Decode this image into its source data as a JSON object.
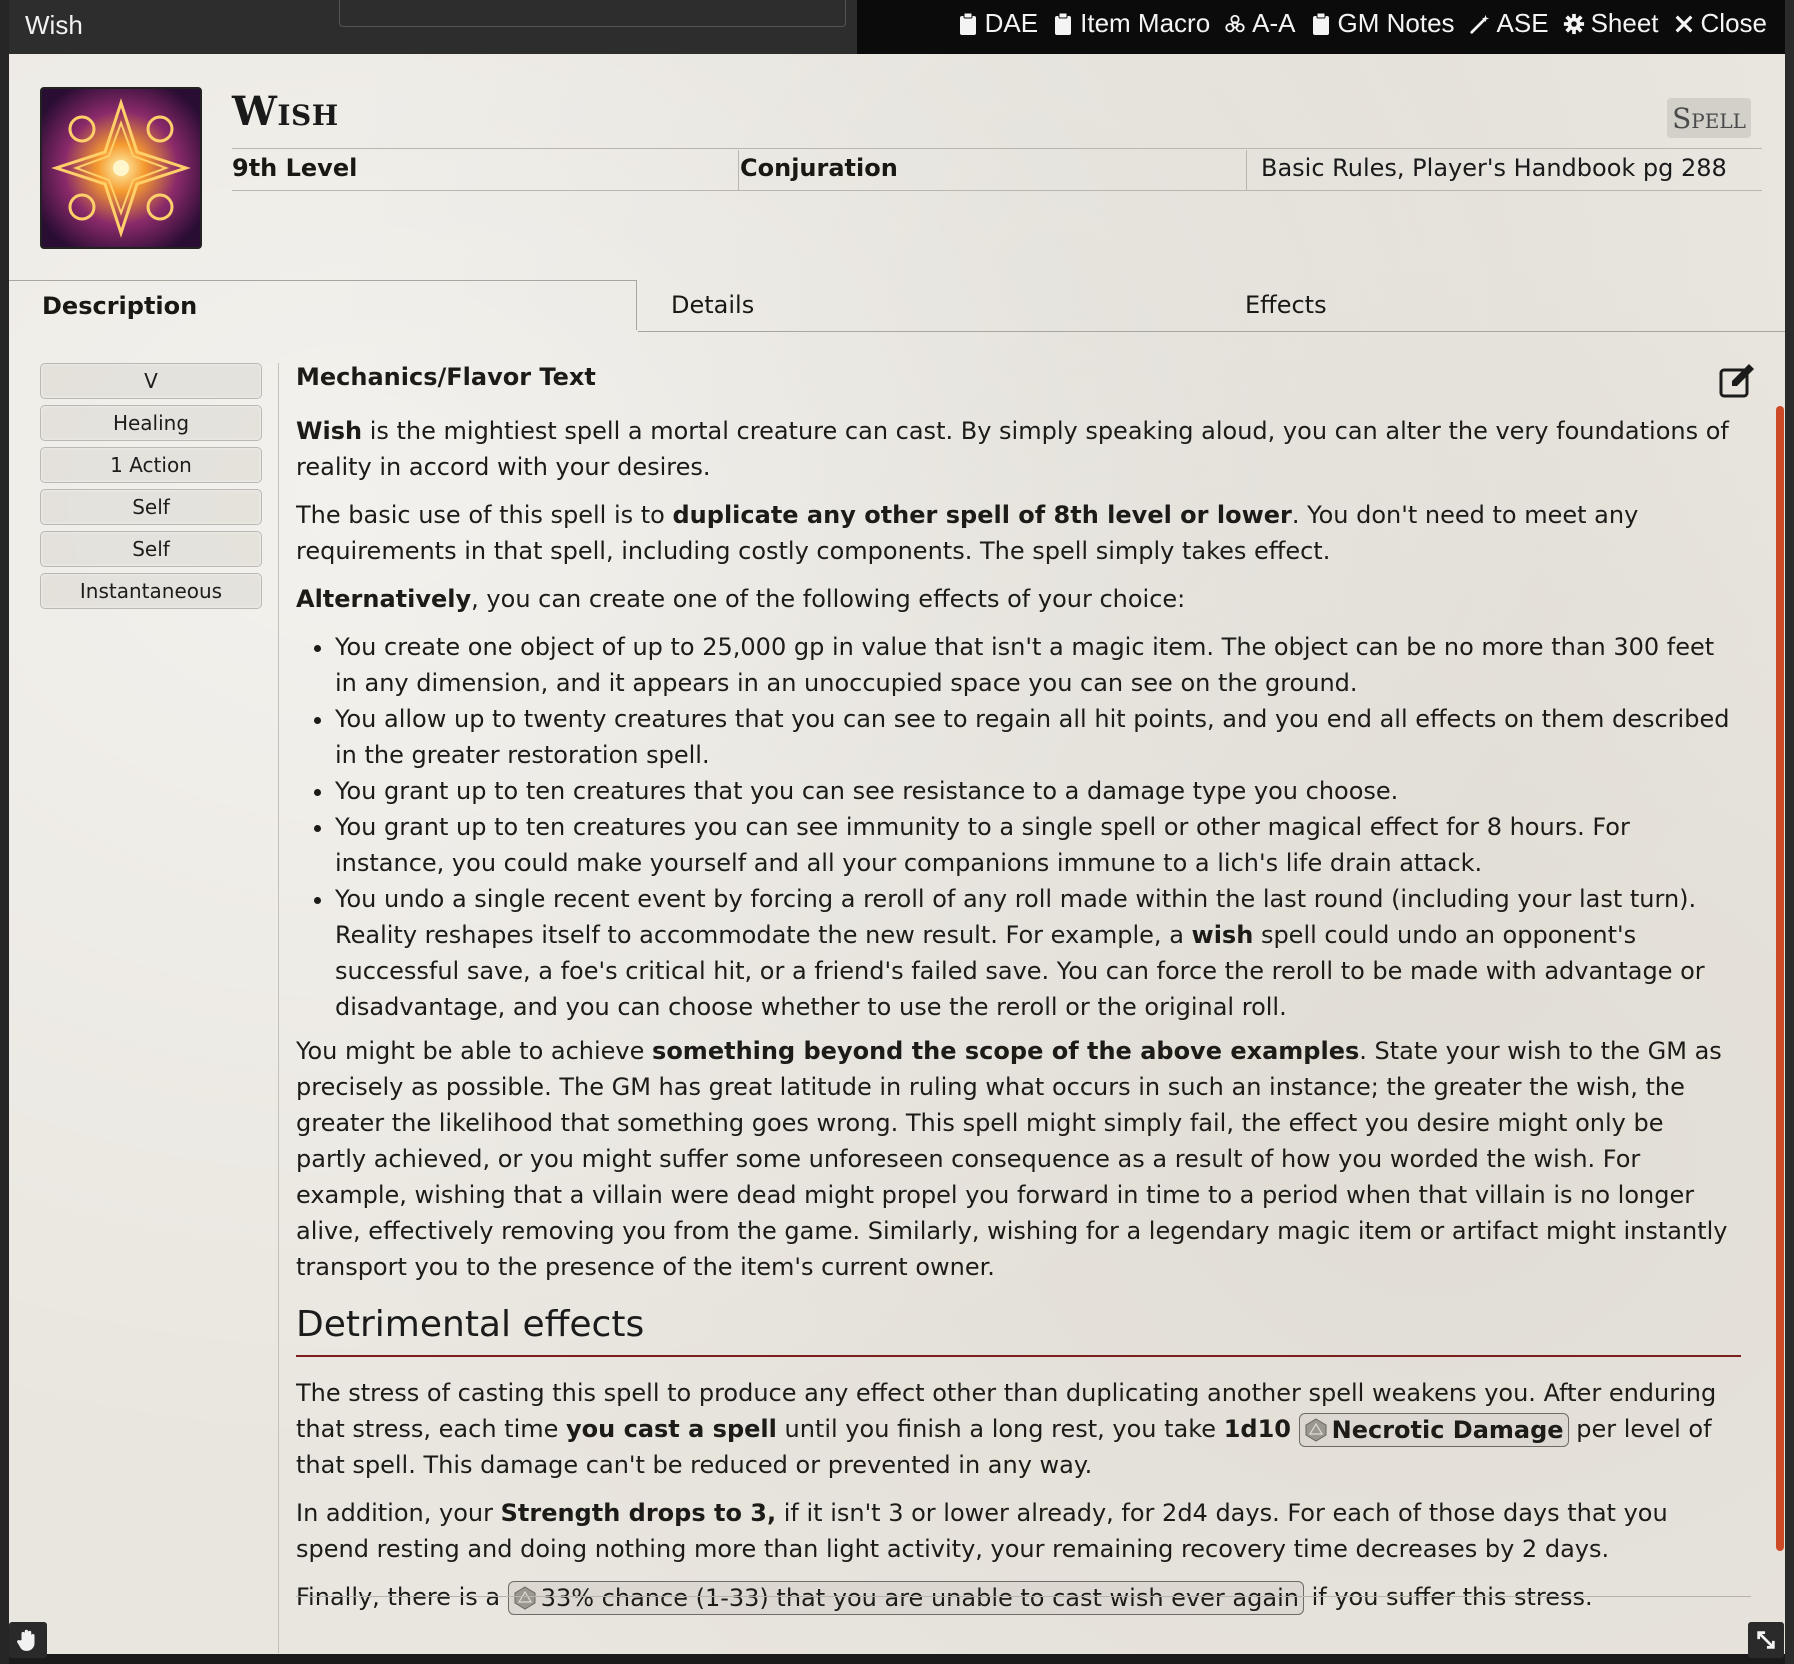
{
  "window": {
    "title": "Wish",
    "header_buttons": [
      {
        "icon": "clipboard-icon",
        "label": "DAE"
      },
      {
        "icon": "clipboard-icon",
        "label": "Item Macro"
      },
      {
        "icon": "biohazard-icon",
        "label": "A-A"
      },
      {
        "icon": "clipboard-icon",
        "label": "GM Notes"
      },
      {
        "icon": "magic-wand-icon",
        "label": "ASE"
      },
      {
        "icon": "gear-icon",
        "label": "Sheet"
      },
      {
        "icon": "close-icon",
        "label": "Close"
      }
    ]
  },
  "item": {
    "name": "Wish",
    "type": "Spell",
    "level": "9th Level",
    "school": "Conjuration",
    "source": "Basic Rules, Player's Handbook pg 288"
  },
  "tabs": [
    "Description",
    "Details",
    "Effects"
  ],
  "properties": [
    "V",
    "Healing",
    "1 Action",
    "Self",
    "Self",
    "Instantaneous"
  ],
  "description": {
    "section_title": "Mechanics/Flavor Text",
    "p1_bold": "Wish",
    "p1_rest": " is the mightiest spell a mortal creature can cast. By simply speaking aloud, you can alter the very foundations of reality in accord with your desires.",
    "p2_start": "The basic use of this spell is to ",
    "p2_bold": "duplicate any other spell of 8th level or lower",
    "p2_end": ". You don't need to meet any requirements in that spell, including costly components. The spell simply takes effect.",
    "p3_bold": "Alternatively",
    "p3_rest": ", you can create one of the following effects of your choice:",
    "bullets": [
      "You create one object of up to 25,000 gp in value that isn't a magic item. The object can be no more than 300 feet in any dimension, and it appears in an unoccupied space you can see on the ground.",
      "You allow up to twenty creatures that you can see to regain all hit points, and you end all effects on them described in the greater restoration spell.",
      "You grant up to ten creatures that you can see resistance to a damage type you choose.",
      "You grant up to ten creatures you can see immunity to a single spell or other magical effect for 8 hours. For instance, you could make yourself and all your companions immune to a lich's life drain attack."
    ],
    "b5_start": "You undo a single recent event by forcing a reroll of any roll made within the last round (including your last turn). Reality reshapes itself to accommodate the new result. For example, a ",
    "b5_bold": "wish",
    "b5_end": " spell could undo an opponent's successful save, a foe's critical hit, or a friend's failed save. You can force the reroll to be made with advantage or disadvantage, and you can choose whether to use the reroll or the original roll.",
    "p4_start": "You might be able to achieve ",
    "p4_bold": "something beyond the scope of the above examples",
    "p4_end": ". State your wish to the GM as precisely as possible. The GM has great latitude in ruling what occurs in such an instance; the greater the wish, the greater the likelihood that something goes wrong. This spell might simply fail, the effect you desire might only be partly achieved, or you might suffer some unforeseen consequence as a result of how you worded the wish. For example, wishing that a villain were dead might propel you forward in time to a period when that villain is no longer alive, effectively removing you from the game. Similarly, wishing for a legendary magic item or artifact might instantly transport you to the presence of the item's current owner.",
    "heading": "Detrimental effects",
    "d1_start": "The stress of casting this spell to produce any effect other than duplicating another spell weakens you. After enduring that stress, each time ",
    "d1_bold": "you cast a spell",
    "d1_mid": " until you finish a long rest, you take ",
    "d1_dice": "1d10",
    "d1_chip": "Necrotic Damage",
    "d1_end": " per level of that spell. This damage can't be reduced or prevented in any way.",
    "d2_start": "In addition, your ",
    "d2_bold": "Strength drops to 3,",
    "d2_end": " if it isn't 3 or lower already, for 2d4 days. For each of those days that you spend resting and doing nothing more than light activity, your remaining recovery time decreases by 2 days.",
    "d3_start": "Finally, there is a ",
    "d3_chip": "33% chance (1-33) that you are unable to cast wish ever again",
    "d3_end": " if you suffer this stress."
  },
  "colors": {
    "accent_red": "#cc4a26",
    "heading_rule": "#7a1e1e",
    "titlebar": "#0b0b0b",
    "paper": "#e9e6df"
  }
}
